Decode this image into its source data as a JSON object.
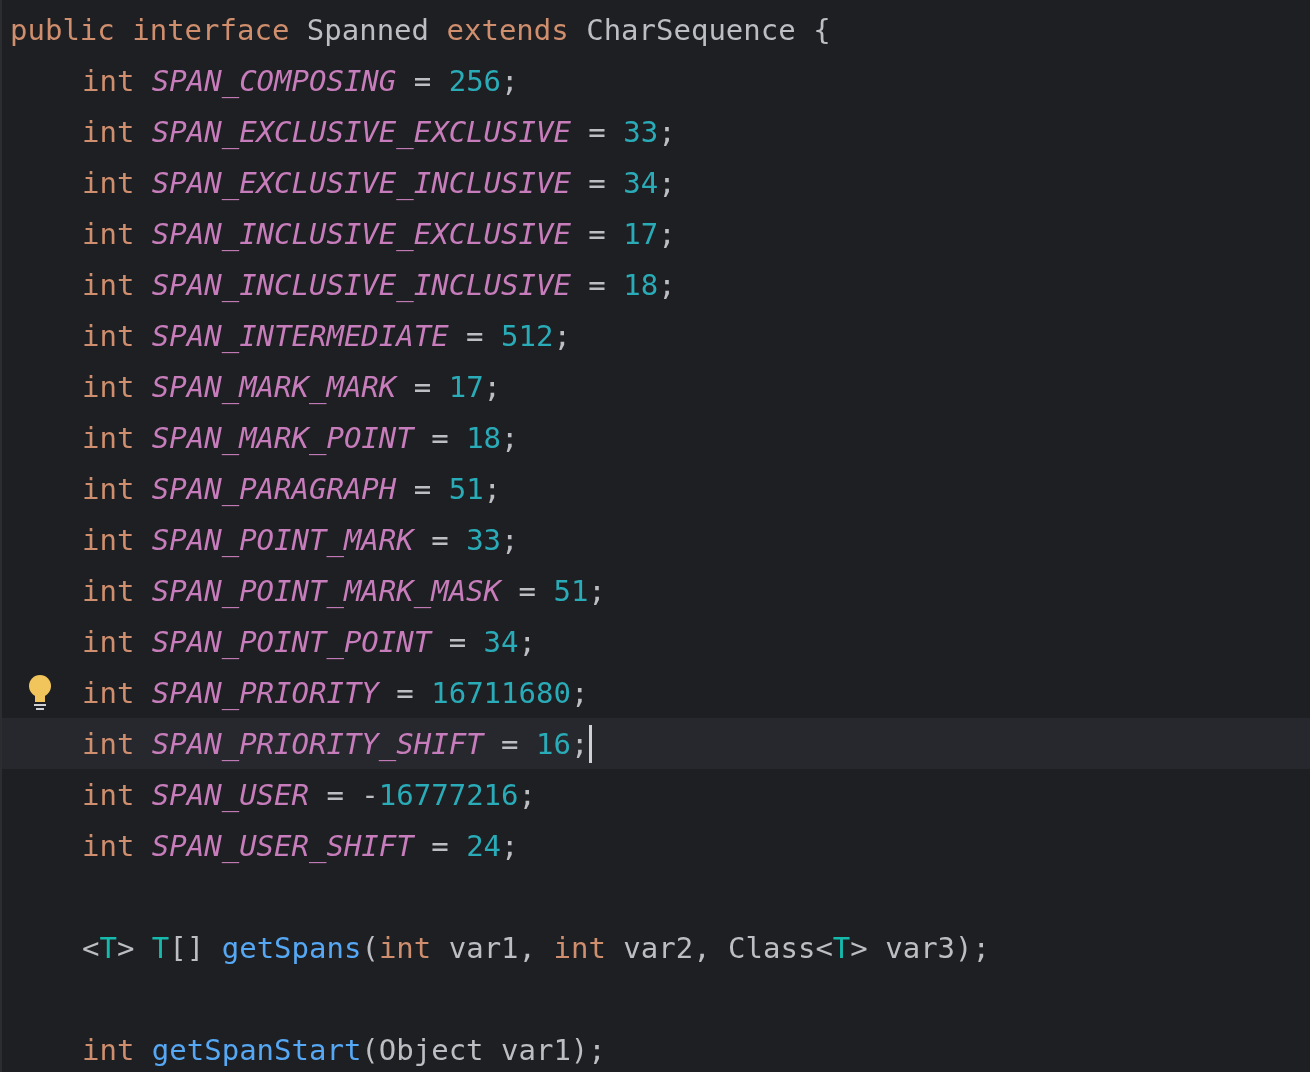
{
  "editor": {
    "header": {
      "tokens": [
        {
          "kind": "keyword",
          "text": "public interface "
        },
        {
          "kind": "plain",
          "text": "Spanned "
        },
        {
          "kind": "keyword",
          "text": "extends "
        },
        {
          "kind": "plain",
          "text": "CharSequence {"
        }
      ]
    },
    "members": [
      {
        "kind": "code",
        "current": false,
        "tokens": [
          {
            "kind": "keyword",
            "text": "int "
          },
          {
            "kind": "constant",
            "text": "SPAN_COMPOSING"
          },
          {
            "kind": "plain",
            "text": " = "
          },
          {
            "kind": "number",
            "text": "256"
          },
          {
            "kind": "plain",
            "text": ";"
          }
        ]
      },
      {
        "kind": "code",
        "current": false,
        "tokens": [
          {
            "kind": "keyword",
            "text": "int "
          },
          {
            "kind": "constant",
            "text": "SPAN_EXCLUSIVE_EXCLUSIVE"
          },
          {
            "kind": "plain",
            "text": " = "
          },
          {
            "kind": "number",
            "text": "33"
          },
          {
            "kind": "plain",
            "text": ";"
          }
        ]
      },
      {
        "kind": "code",
        "current": false,
        "tokens": [
          {
            "kind": "keyword",
            "text": "int "
          },
          {
            "kind": "constant",
            "text": "SPAN_EXCLUSIVE_INCLUSIVE"
          },
          {
            "kind": "plain",
            "text": " = "
          },
          {
            "kind": "number",
            "text": "34"
          },
          {
            "kind": "plain",
            "text": ";"
          }
        ]
      },
      {
        "kind": "code",
        "current": false,
        "tokens": [
          {
            "kind": "keyword",
            "text": "int "
          },
          {
            "kind": "constant",
            "text": "SPAN_INCLUSIVE_EXCLUSIVE"
          },
          {
            "kind": "plain",
            "text": " = "
          },
          {
            "kind": "number",
            "text": "17"
          },
          {
            "kind": "plain",
            "text": ";"
          }
        ]
      },
      {
        "kind": "code",
        "current": false,
        "tokens": [
          {
            "kind": "keyword",
            "text": "int "
          },
          {
            "kind": "constant",
            "text": "SPAN_INCLUSIVE_INCLUSIVE"
          },
          {
            "kind": "plain",
            "text": " = "
          },
          {
            "kind": "number",
            "text": "18"
          },
          {
            "kind": "plain",
            "text": ";"
          }
        ]
      },
      {
        "kind": "code",
        "current": false,
        "tokens": [
          {
            "kind": "keyword",
            "text": "int "
          },
          {
            "kind": "constant",
            "text": "SPAN_INTERMEDIATE"
          },
          {
            "kind": "plain",
            "text": " = "
          },
          {
            "kind": "number",
            "text": "512"
          },
          {
            "kind": "plain",
            "text": ";"
          }
        ]
      },
      {
        "kind": "code",
        "current": false,
        "tokens": [
          {
            "kind": "keyword",
            "text": "int "
          },
          {
            "kind": "constant",
            "text": "SPAN_MARK_MARK"
          },
          {
            "kind": "plain",
            "text": " = "
          },
          {
            "kind": "number",
            "text": "17"
          },
          {
            "kind": "plain",
            "text": ";"
          }
        ]
      },
      {
        "kind": "code",
        "current": false,
        "tokens": [
          {
            "kind": "keyword",
            "text": "int "
          },
          {
            "kind": "constant",
            "text": "SPAN_MARK_POINT"
          },
          {
            "kind": "plain",
            "text": " = "
          },
          {
            "kind": "number",
            "text": "18"
          },
          {
            "kind": "plain",
            "text": ";"
          }
        ]
      },
      {
        "kind": "code",
        "current": false,
        "tokens": [
          {
            "kind": "keyword",
            "text": "int "
          },
          {
            "kind": "constant",
            "text": "SPAN_PARAGRAPH"
          },
          {
            "kind": "plain",
            "text": " = "
          },
          {
            "kind": "number",
            "text": "51"
          },
          {
            "kind": "plain",
            "text": ";"
          }
        ]
      },
      {
        "kind": "code",
        "current": false,
        "tokens": [
          {
            "kind": "keyword",
            "text": "int "
          },
          {
            "kind": "constant",
            "text": "SPAN_POINT_MARK"
          },
          {
            "kind": "plain",
            "text": " = "
          },
          {
            "kind": "number",
            "text": "33"
          },
          {
            "kind": "plain",
            "text": ";"
          }
        ]
      },
      {
        "kind": "code",
        "current": false,
        "tokens": [
          {
            "kind": "keyword",
            "text": "int "
          },
          {
            "kind": "constant",
            "text": "SPAN_POINT_MARK_MASK"
          },
          {
            "kind": "plain",
            "text": " = "
          },
          {
            "kind": "number",
            "text": "51"
          },
          {
            "kind": "plain",
            "text": ";"
          }
        ]
      },
      {
        "kind": "code",
        "current": false,
        "tokens": [
          {
            "kind": "keyword",
            "text": "int "
          },
          {
            "kind": "constant",
            "text": "SPAN_POINT_POINT"
          },
          {
            "kind": "plain",
            "text": " = "
          },
          {
            "kind": "number",
            "text": "34"
          },
          {
            "kind": "plain",
            "text": ";"
          }
        ]
      },
      {
        "kind": "code",
        "current": false,
        "bulb": true,
        "tokens": [
          {
            "kind": "keyword",
            "text": "int "
          },
          {
            "kind": "constant",
            "text": "SPAN_PRIORITY"
          },
          {
            "kind": "plain",
            "text": " = "
          },
          {
            "kind": "number",
            "text": "16711680"
          },
          {
            "kind": "plain",
            "text": ";"
          }
        ]
      },
      {
        "kind": "code",
        "current": true,
        "tokens": [
          {
            "kind": "keyword",
            "text": "int "
          },
          {
            "kind": "constant",
            "text": "SPAN_PRIORITY_SHIFT"
          },
          {
            "kind": "plain",
            "text": " = "
          },
          {
            "kind": "number",
            "text": "16"
          },
          {
            "kind": "plain",
            "text": ";"
          }
        ]
      },
      {
        "kind": "code",
        "current": false,
        "tokens": [
          {
            "kind": "keyword",
            "text": "int "
          },
          {
            "kind": "constant",
            "text": "SPAN_USER"
          },
          {
            "kind": "plain",
            "text": " = -"
          },
          {
            "kind": "number",
            "text": "16777216"
          },
          {
            "kind": "plain",
            "text": ";"
          }
        ]
      },
      {
        "kind": "code",
        "current": false,
        "tokens": [
          {
            "kind": "keyword",
            "text": "int "
          },
          {
            "kind": "constant",
            "text": "SPAN_USER_SHIFT"
          },
          {
            "kind": "plain",
            "text": " = "
          },
          {
            "kind": "number",
            "text": "24"
          },
          {
            "kind": "plain",
            "text": ";"
          }
        ]
      },
      {
        "kind": "blank"
      },
      {
        "kind": "code",
        "current": false,
        "tokens": [
          {
            "kind": "plain",
            "text": "<"
          },
          {
            "kind": "type_param",
            "text": "T"
          },
          {
            "kind": "plain",
            "text": "> "
          },
          {
            "kind": "type_param",
            "text": "T"
          },
          {
            "kind": "plain",
            "text": "[] "
          },
          {
            "kind": "method",
            "text": "getSpans"
          },
          {
            "kind": "plain",
            "text": "("
          },
          {
            "kind": "keyword",
            "text": "int "
          },
          {
            "kind": "plain",
            "text": "var1, "
          },
          {
            "kind": "keyword",
            "text": "int "
          },
          {
            "kind": "plain",
            "text": "var2, Class<"
          },
          {
            "kind": "type_param",
            "text": "T"
          },
          {
            "kind": "plain",
            "text": "> var3);"
          }
        ]
      },
      {
        "kind": "blank"
      },
      {
        "kind": "code",
        "current": false,
        "tokens": [
          {
            "kind": "keyword",
            "text": "int "
          },
          {
            "kind": "method",
            "text": "getSpanStart"
          },
          {
            "kind": "plain",
            "text": "(Object var1);"
          }
        ]
      }
    ]
  }
}
